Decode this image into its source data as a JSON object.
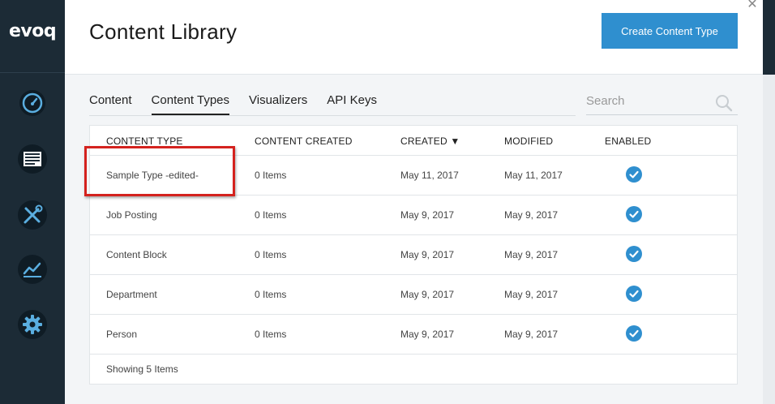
{
  "app": {
    "logo": "evoq"
  },
  "sidebar": {
    "items": [
      {
        "icon": "dashboard-icon"
      },
      {
        "icon": "content-icon"
      },
      {
        "icon": "tools-icon"
      },
      {
        "icon": "analytics-icon"
      },
      {
        "icon": "settings-gear-icon"
      }
    ]
  },
  "header": {
    "title": "Content Library",
    "create_button": "Create Content Type"
  },
  "tabs": [
    {
      "label": "Content",
      "active": false
    },
    {
      "label": "Content Types",
      "active": true
    },
    {
      "label": "Visualizers",
      "active": false
    },
    {
      "label": "API Keys",
      "active": false
    }
  ],
  "search": {
    "placeholder": "Search",
    "value": ""
  },
  "table": {
    "columns": [
      "CONTENT TYPE",
      "CONTENT CREATED",
      "CREATED ▼",
      "MODIFIED",
      "ENABLED"
    ],
    "rows": [
      {
        "type": "Sample Type -edited-",
        "created_count": "0 Items",
        "created": "May 11, 2017",
        "modified": "May 11, 2017",
        "enabled": true
      },
      {
        "type": "Job Posting",
        "created_count": "0 Items",
        "created": "May 9, 2017",
        "modified": "May 9, 2017",
        "enabled": true
      },
      {
        "type": "Content Block",
        "created_count": "0 Items",
        "created": "May 9, 2017",
        "modified": "May 9, 2017",
        "enabled": true
      },
      {
        "type": "Department",
        "created_count": "0 Items",
        "created": "May 9, 2017",
        "modified": "May 9, 2017",
        "enabled": true
      },
      {
        "type": "Person",
        "created_count": "0 Items",
        "created": "May 9, 2017",
        "modified": "May 9, 2017",
        "enabled": true
      }
    ],
    "footer": "Showing 5 Items"
  },
  "colors": {
    "sidebar_bg": "#1c2b36",
    "icon_blue": "#5aaee0",
    "accent": "#2f8fcf",
    "highlight": "#d4221e"
  }
}
